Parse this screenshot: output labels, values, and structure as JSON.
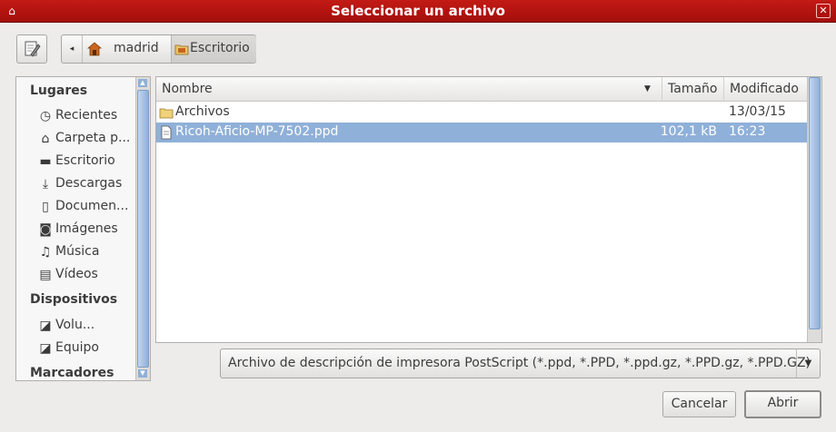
{
  "window": {
    "title": "Seleccionar un archivo",
    "accent": "#b8130f"
  },
  "toolbar": {
    "edit_icon": "edit-location-icon",
    "path": [
      {
        "label": "madrid",
        "icon": "home-folder-icon"
      },
      {
        "label": "Escritorio",
        "icon": "desktop-folder-icon"
      }
    ]
  },
  "sidebar": {
    "places_header": "Lugares",
    "places": [
      {
        "label": "Recientes",
        "icon": "clock-icon"
      },
      {
        "label": "Carpeta p...",
        "icon": "home-icon"
      },
      {
        "label": "Escritorio",
        "icon": "folder-icon"
      },
      {
        "label": "Descargas",
        "icon": "download-icon"
      },
      {
        "label": "Documen...",
        "icon": "document-icon"
      },
      {
        "label": "Imágenes",
        "icon": "camera-icon"
      },
      {
        "label": "Música",
        "icon": "music-icon"
      },
      {
        "label": "Vídeos",
        "icon": "film-icon"
      }
    ],
    "devices_header": "Dispositivos",
    "devices": [
      {
        "label": "Volu...",
        "icon": "drive-icon",
        "eject": true
      },
      {
        "label": "Equipo",
        "icon": "drive-icon"
      }
    ],
    "bookmarks_header": "Marcadores"
  },
  "files": {
    "columns": {
      "name": "Nombre",
      "size": "Tamaño",
      "modified": "Modificado"
    },
    "rows": [
      {
        "name": "Archivos",
        "size": "",
        "modified": "13/03/15",
        "type": "folder",
        "selected": false
      },
      {
        "name": "Ricoh-Aficio-MP-7502.ppd",
        "size": "102,1 kB",
        "modified": "16:23",
        "type": "file",
        "selected": true
      }
    ]
  },
  "filter": {
    "selected": "Archivo de descripción de impresora PostScript (*.ppd, *.PPD, *.ppd.gz, *.PPD.gz, *.PPD.GZ)"
  },
  "buttons": {
    "cancel": "Cancelar",
    "open": "Abrir"
  }
}
